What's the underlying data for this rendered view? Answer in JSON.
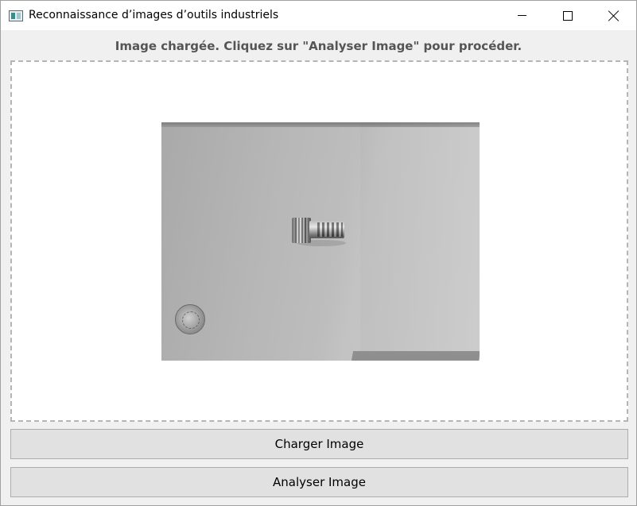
{
  "window": {
    "title": "Reconnaissance d’images d’outils industriels"
  },
  "titlebar_controls": {
    "minimize_icon": "minimize-icon",
    "maximize_icon": "maximize-icon",
    "close_icon": "close-icon"
  },
  "status": {
    "message": "Image chargée. Cliquez sur \"Analyser Image\" pour procéder."
  },
  "image_preview": {
    "description_icon": "loaded-photo"
  },
  "buttons": {
    "load_label": "Charger Image",
    "analyze_label": "Analyser Image"
  },
  "colors": {
    "window_bg": "#f0f0f0",
    "status_text": "#555555",
    "button_bg": "#e1e1e1",
    "dashed_border": "#b5b5b5"
  }
}
